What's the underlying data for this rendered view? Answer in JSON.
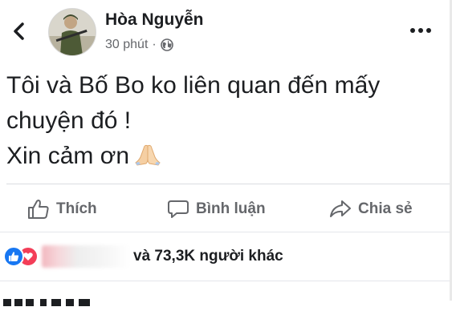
{
  "header": {
    "back_icon": "chevron-left-icon",
    "author_name": "Hòa Nguyễn",
    "timestamp": "30 phút",
    "separator": "·",
    "privacy_icon": "globe-icon",
    "more_icon": "more-horizontal-icon"
  },
  "post": {
    "lines": [
      "Tôi và Bố Bo ko liên quan đến mấy",
      "chuyện đó !",
      "Xin cảm ơn"
    ],
    "emoji": "folded-hands-emoji"
  },
  "actions": {
    "like_label": "Thích",
    "comment_label": "Bình luận",
    "share_label": "Chia sẻ"
  },
  "reactions": {
    "summary": "và 73,3K người khác"
  },
  "colors": {
    "text": "#1c1e21",
    "secondary_text": "#65676b",
    "like_blue": "#1877f2",
    "love_red": "#f33e58",
    "divider": "#dadde1"
  }
}
